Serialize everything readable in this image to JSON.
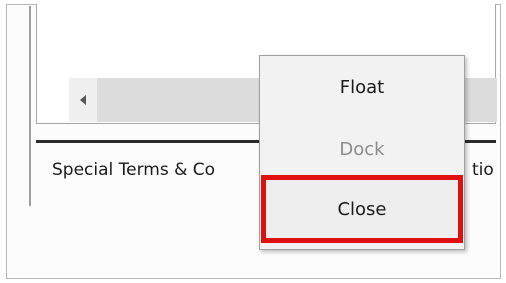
{
  "tab": {
    "label": "Special Terms & Co",
    "label_tail": "tio"
  },
  "context_menu": {
    "items": [
      {
        "label": "Float",
        "enabled": true
      },
      {
        "label": "Dock",
        "enabled": false
      },
      {
        "label": "Close",
        "enabled": true,
        "highlighted": true
      }
    ],
    "highlight_color": "#e01010"
  },
  "icons": {
    "scroll_left": "triangle-left-icon"
  }
}
